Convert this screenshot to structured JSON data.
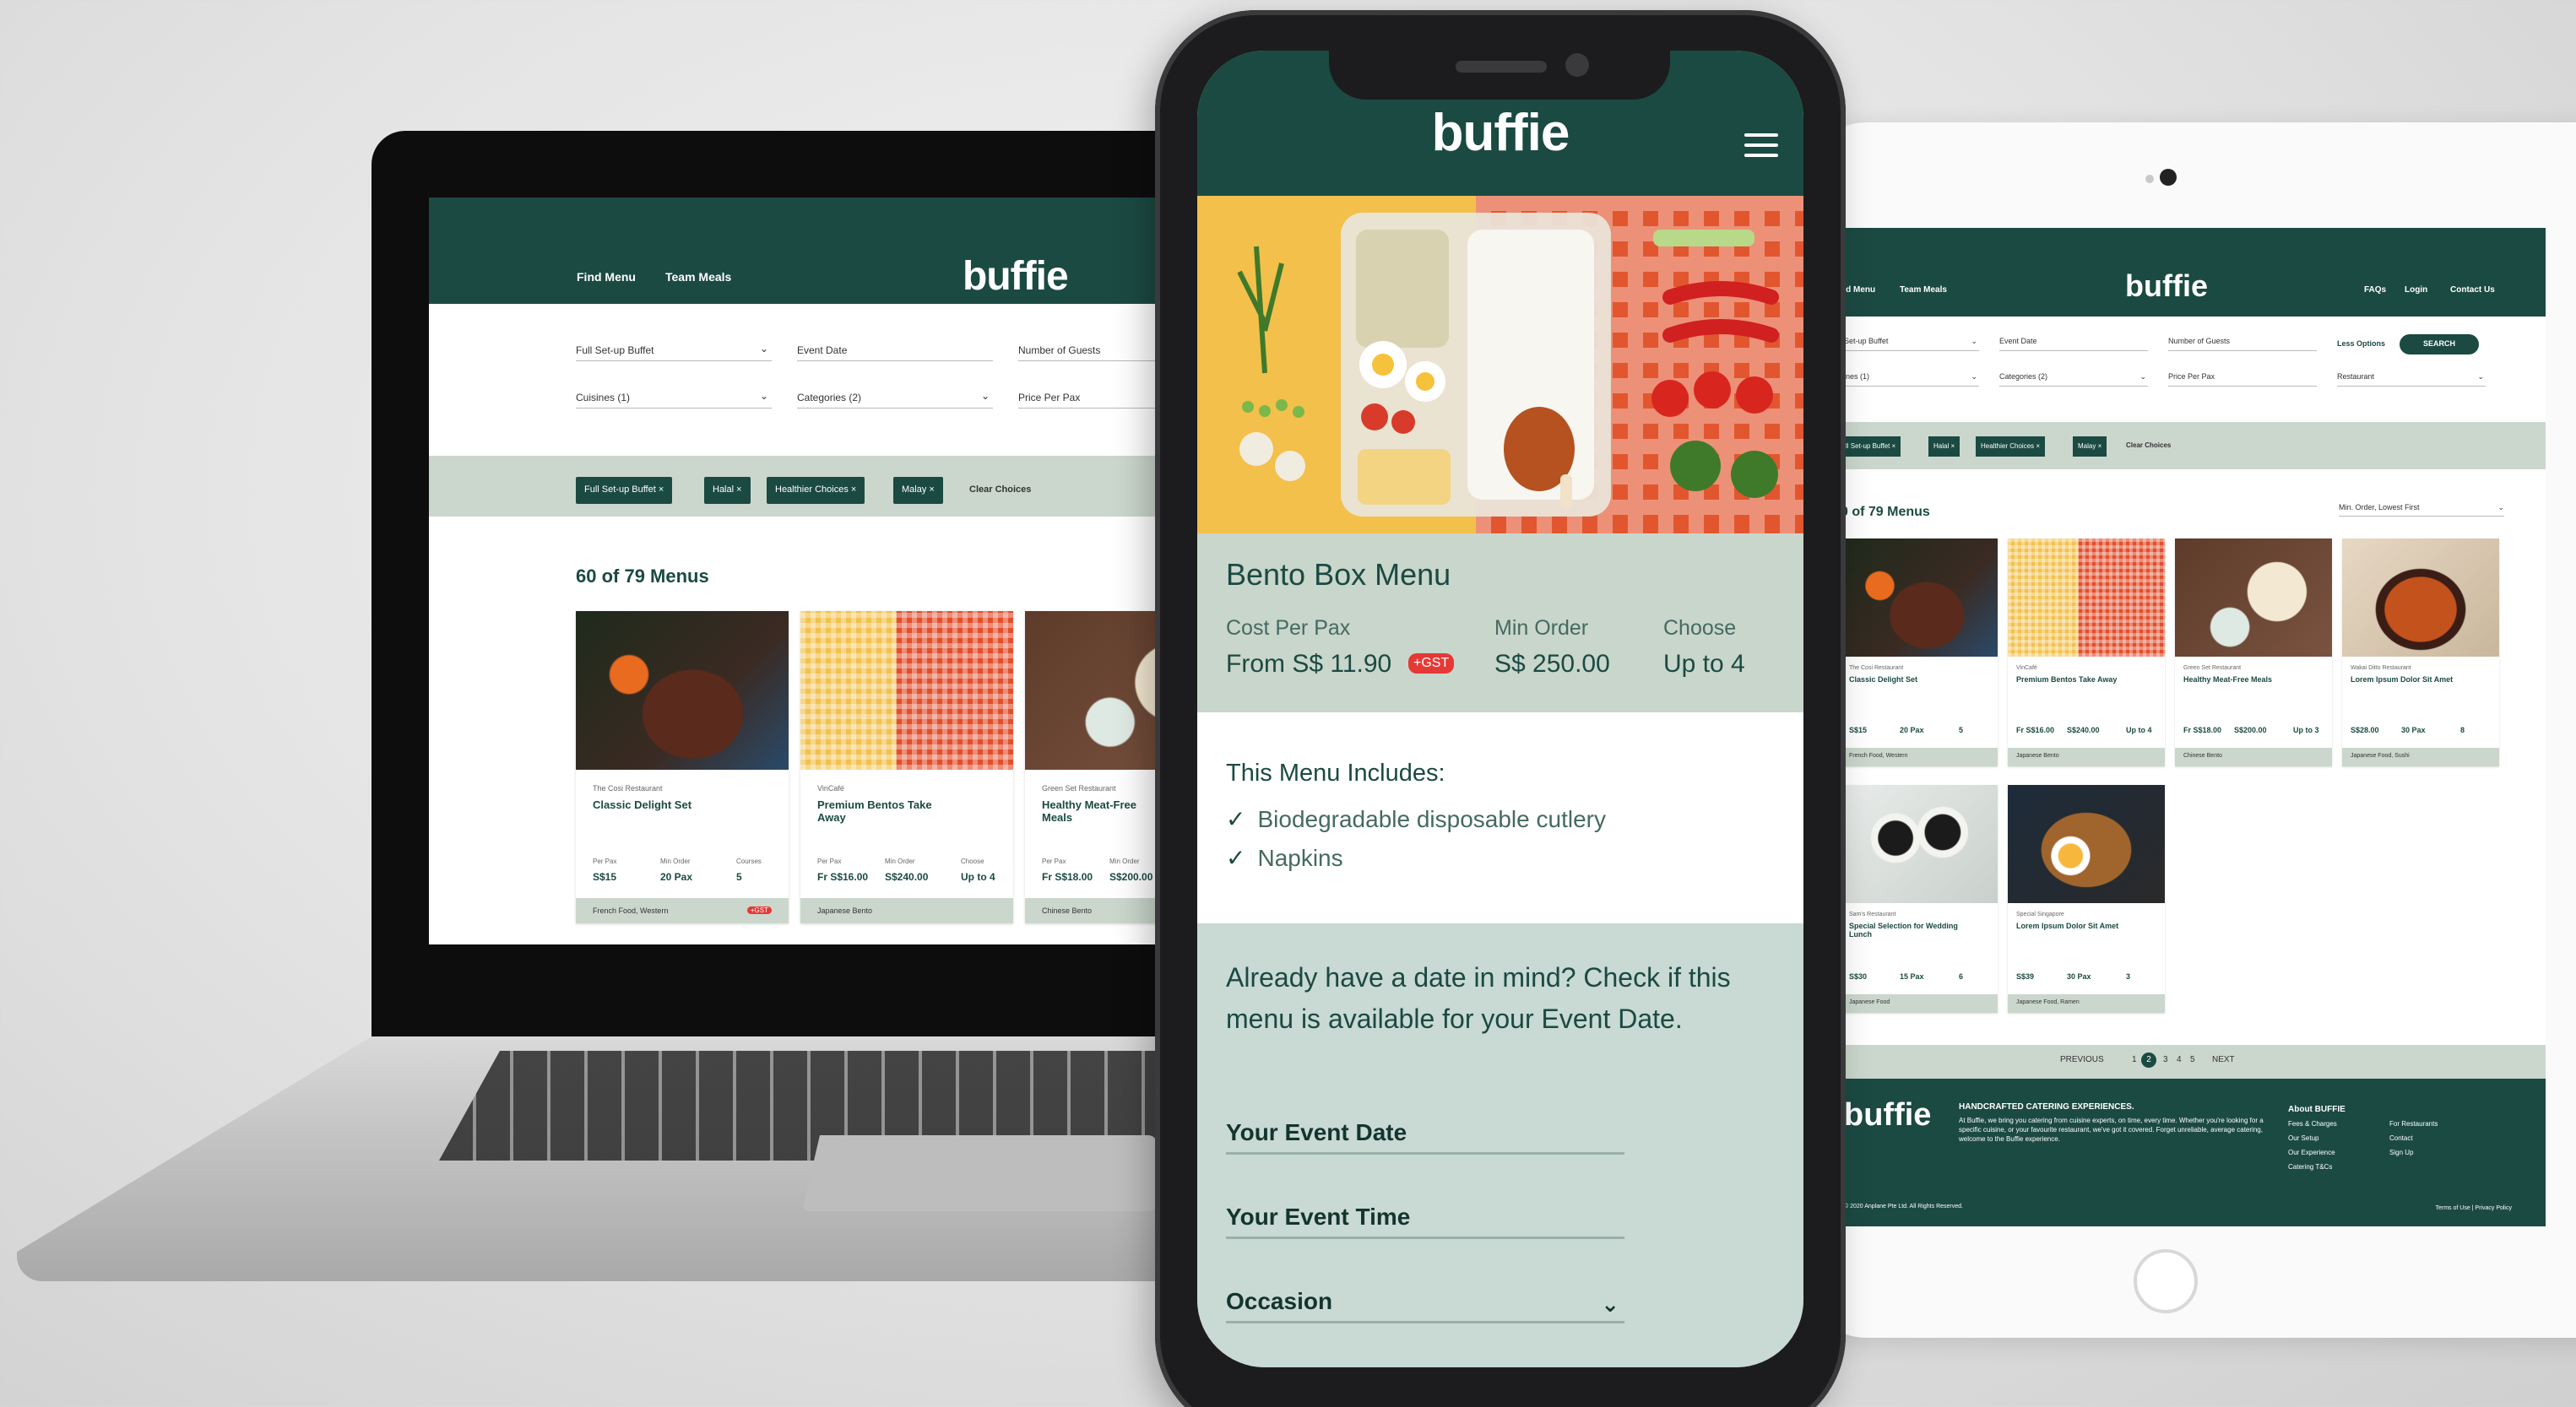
{
  "laptop": {
    "nav": [
      "Find Menu",
      "Team Meals"
    ],
    "logo": "buffie",
    "fields": {
      "service": "Full Set-up Buffet",
      "event_date": "Event Date",
      "guests": "Number of Guests",
      "cuisines": "Cuisines (1)",
      "categories": "Categories (2)",
      "price": "Price Per Pax"
    },
    "chips": [
      "Full Set-up Buffet ×",
      "Halal ×",
      "Healthier Choices ×",
      "Malay ×"
    ],
    "clear": "Clear Choices",
    "count": "60 of 79 Menus",
    "cards": [
      {
        "restaurant": "The Cosi Restaurant",
        "name": "Classic Delight Set",
        "l1": "Per Pax",
        "v1": "S$15",
        "l2": "Min Order",
        "v2": "20 Pax",
        "l3": "Courses",
        "v3": "5",
        "cuisine": "French Food, Western",
        "badge": "+GST"
      },
      {
        "restaurant": "VinCafé",
        "name": "Premium Bentos Take Away",
        "l1": "Per Pax",
        "v1": "Fr S$16.00",
        "l2": "Min Order",
        "v2": "S$240.00",
        "l3": "Choose",
        "v3": "Up to 4",
        "cuisine": "Japanese Bento",
        "badge": ""
      },
      {
        "restaurant": "Green Set Restaurant",
        "name": "Healthy Meat-Free Meals",
        "l1": "Per Pax",
        "v1": "Fr S$18.00",
        "l2": "Min Order",
        "v2": "S$200.00",
        "l3": "",
        "v3": "",
        "cuisine": "Chinese Bento",
        "badge": ""
      }
    ]
  },
  "phone": {
    "logo": "buffie",
    "title": "Bento Box Menu",
    "cost_label": "Cost Per Pax",
    "cost_value": "From S$ 11.90",
    "gst": "+GST",
    "min_label": "Min Order",
    "min_value": "S$ 250.00",
    "choose_label": "Choose",
    "choose_value": "Up to 4",
    "includes_title": "This Menu Includes:",
    "includes": [
      "Biodegradable disposable cutlery",
      "Napkins"
    ],
    "availability_text": "Already have a date in mind? Check if this menu is available for your Event Date.",
    "date_field": "Your Event Date",
    "time_field": "Your Event Time",
    "occasion_field": "Occasion"
  },
  "tablet": {
    "nav_left": [
      "nd Menu",
      "Team Meals"
    ],
    "nav_right": [
      "FAQs",
      "Login",
      "Contact Us"
    ],
    "logo": "buffie",
    "fields": {
      "service": "Set-up Buffet",
      "event_date": "Event Date",
      "guests": "Number of Guests",
      "cuisines": "ines (1)",
      "categories": "Categories (2)",
      "price": "Price Per Pax",
      "restaurant": "Restaurant"
    },
    "less_options": "Less Options",
    "search": "SEARCH",
    "chips": [
      "ll Set-up Buffet ×",
      "Halal ×",
      "Healthier Choices ×",
      "Malay ×"
    ],
    "clear": "Clear Choices",
    "count": "0 of 79 Menus",
    "sort": "Min. Order, Lowest First",
    "cards": [
      {
        "restaurant": "The Cosi Restaurant",
        "name": "Classic Delight Set",
        "v1": "S$15",
        "v2": "20 Pax",
        "v3": "5",
        "cuisine": "French Food, Western"
      },
      {
        "restaurant": "VinCafé",
        "name": "Premium Bentos Take Away",
        "v1": "Fr S$16.00",
        "v2": "S$240.00",
        "v3": "Up to 4",
        "cuisine": "Japanese Bento"
      },
      {
        "restaurant": "Green Set Restaurant",
        "name": "Healthy Meat-Free Meals",
        "v1": "Fr S$18.00",
        "v2": "S$200.00",
        "v3": "Up to 3",
        "cuisine": "Chinese Bento"
      },
      {
        "restaurant": "Wakai Ditto Restaurant",
        "name": "Lorem Ipsum Dolor Sit Amet",
        "v1": "S$28.00",
        "v2": "30 Pax",
        "v3": "8",
        "cuisine": "Japanese Food, Sushi"
      },
      {
        "restaurant": "Sam's Restaurant",
        "name": "Special Selection for Wedding Lunch",
        "v1": "S$30",
        "v2": "15 Pax",
        "v3": "6",
        "cuisine": "Japanese Food"
      },
      {
        "restaurant": "Special Singapore",
        "name": "Lorem Ipsum Dolor Sit Amet",
        "v1": "S$39",
        "v2": "30 Pax",
        "v3": "3",
        "cuisine": "Japanese Food, Ramen"
      }
    ],
    "pagination": {
      "prev": "PREVIOUS",
      "pages": [
        "1",
        "2",
        "3",
        "4",
        "5"
      ],
      "next": "NEXT",
      "current": "2"
    },
    "footer": {
      "logo": "buffie",
      "heading": "HANDCRAFTED CATERING EXPERIENCES.",
      "text": "At Buffie, we bring you catering from cuisine experts, on time, every time. Whether you're looking for a specific cuisine, or your favourite restaurant, we've got it covered. Forget unreliable, average catering, welcome to the Buffie experience.",
      "about_title": "About BUFFIE",
      "about_links": [
        "Fees & Charges",
        "Our Setup",
        "Our Experience",
        "Catering T&Cs"
      ],
      "other_links": [
        "For Restaurants",
        "Contact",
        "Sign Up"
      ],
      "copyright": "© 2020 Anplane Pte Ltd. All Rights Reserved.",
      "legal": "Terms of Use  |  Privacy Policy"
    }
  },
  "colors": {
    "brand_green": "#1b4a42",
    "sage": "#cbd7cd",
    "gst_red": "#e53935"
  }
}
